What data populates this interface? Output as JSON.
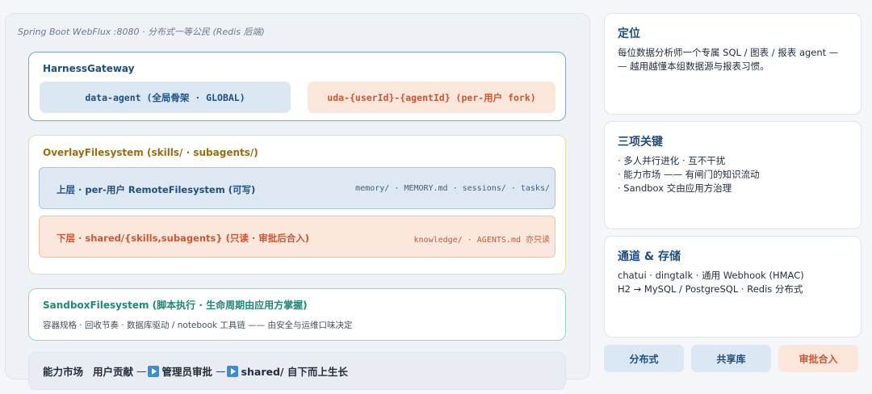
{
  "header": "Spring Boot WebFlux :8080 · 分布式一等公民 (Redis 后端)",
  "gateway": {
    "title": "HarnessGateway",
    "global": "data-agent (全局骨架 · GLOBAL)",
    "fork": "uda-{userId}-{agentId} (per-用户 fork)"
  },
  "overlay": {
    "title": "OverlayFilesystem (skills/ · subagents/)",
    "upper": {
      "label": "上层 · per-用户 RemoteFilesystem (可写)",
      "paths": "memory/ · MEMORY.md · sessions/ · tasks/"
    },
    "lower": {
      "label": "下层 · shared/{skills,subagents} (只读 · 审批后合入)",
      "paths": "knowledge/ · AGENTS.md 亦只读"
    }
  },
  "sandbox": {
    "title": "SandboxFilesystem (脚本执行 · 生命周期由应用方掌握)",
    "desc": "容器规格 · 回收节奏 · 数据库驱动 / notebook 工具链 —— 由安全与运维口味决定"
  },
  "market": {
    "a": "能力市场",
    "b": "用户贡献",
    "c": "管理员审批",
    "d": "shared/ 自下而上生长",
    "arrow": "—"
  },
  "cards": [
    {
      "title": "定位",
      "lines": [
        "每位数据分析师一个专属 SQL / 图表 / 报表 agent —",
        "— 越用越懂本组数据源与报表习惯。"
      ]
    },
    {
      "title": "三项关键",
      "lines": [
        "· 多人并行进化 · 互不干扰",
        "· 能力市场 —— 有闸门的知识流动",
        "· Sandbox 交由应用方治理"
      ]
    },
    {
      "title": "通道 & 存储",
      "lines": [
        "chatui · dingtalk · 通用 Webhook (HMAC)",
        "H2 → MySQL / PostgreSQL · Redis 分布式"
      ]
    }
  ],
  "tags": [
    "分布式",
    "共享库",
    "审批合入"
  ]
}
